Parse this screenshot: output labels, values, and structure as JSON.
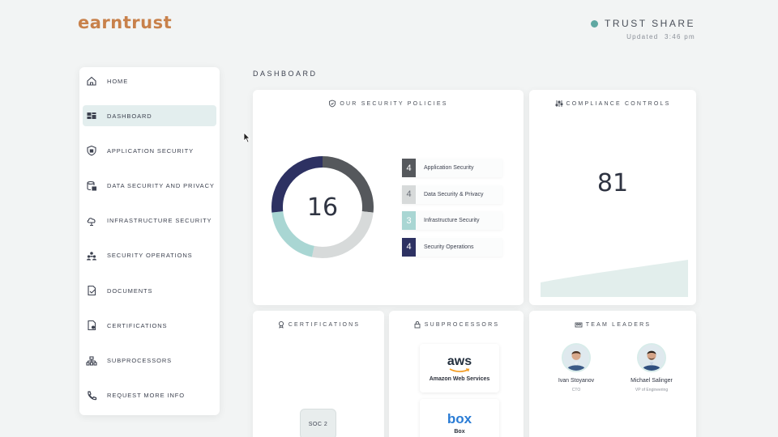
{
  "brand": {
    "name": "earntrust"
  },
  "header": {
    "trust_share_label": "TRUST SHARE",
    "updated_label": "Updated",
    "updated_time": "3:46 pm",
    "status_color": "#5fa8a2"
  },
  "sidebar": {
    "items": [
      {
        "label": "HOME",
        "icon": "home-icon",
        "active": false
      },
      {
        "label": "DASHBOARD",
        "icon": "dashboard-icon",
        "active": true
      },
      {
        "label": "APPLICATION SECURITY",
        "icon": "shield-icon",
        "active": false
      },
      {
        "label": "DATA SECURITY AND PRIVACY",
        "icon": "database-lock-icon",
        "active": false
      },
      {
        "label": "INFRASTRUCTURE SECURITY",
        "icon": "cloud-icon",
        "active": false
      },
      {
        "label": "SECURITY OPERATIONS",
        "icon": "people-icon",
        "active": false
      },
      {
        "label": "DOCUMENTS",
        "icon": "document-icon",
        "active": false
      },
      {
        "label": "CERTIFICATIONS",
        "icon": "certificate-icon",
        "active": false
      },
      {
        "label": "SUBPROCESSORS",
        "icon": "network-icon",
        "active": false
      },
      {
        "label": "REQUEST MORE INFO",
        "icon": "phone-icon",
        "active": false
      }
    ]
  },
  "main": {
    "title": "DASHBOARD",
    "policies": {
      "title": "OUR SECURITY POLICIES",
      "total": "16",
      "items": [
        {
          "count": "4",
          "label": "Application Security",
          "color": "#55585c"
        },
        {
          "count": "4",
          "label": "Data Security & Privacy",
          "color": "#d7dada"
        },
        {
          "count": "3",
          "label": "Infrastructure Security",
          "color": "#a9d6d3"
        },
        {
          "count": "4",
          "label": "Security Operations",
          "color": "#2d3162"
        }
      ]
    },
    "compliance": {
      "title": "COMPLIANCE CONTROLS",
      "count": "81",
      "color": "#e2eeec"
    },
    "certifications": {
      "title": "CERTIFICATIONS",
      "items": [
        {
          "label": "SOC 2"
        }
      ]
    },
    "subprocessors": {
      "title": "SUBPROCESSORS",
      "items": [
        {
          "logo": "aws",
          "name": "Amazon Web Services"
        },
        {
          "logo": "box",
          "name": "Box"
        }
      ]
    },
    "team": {
      "title": "TEAM LEADERS",
      "leaders": [
        {
          "name": "Ivan Stoyanov",
          "role": "CTO"
        },
        {
          "name": "Michael Salinger",
          "role": "VP of Engineering"
        }
      ]
    }
  }
}
